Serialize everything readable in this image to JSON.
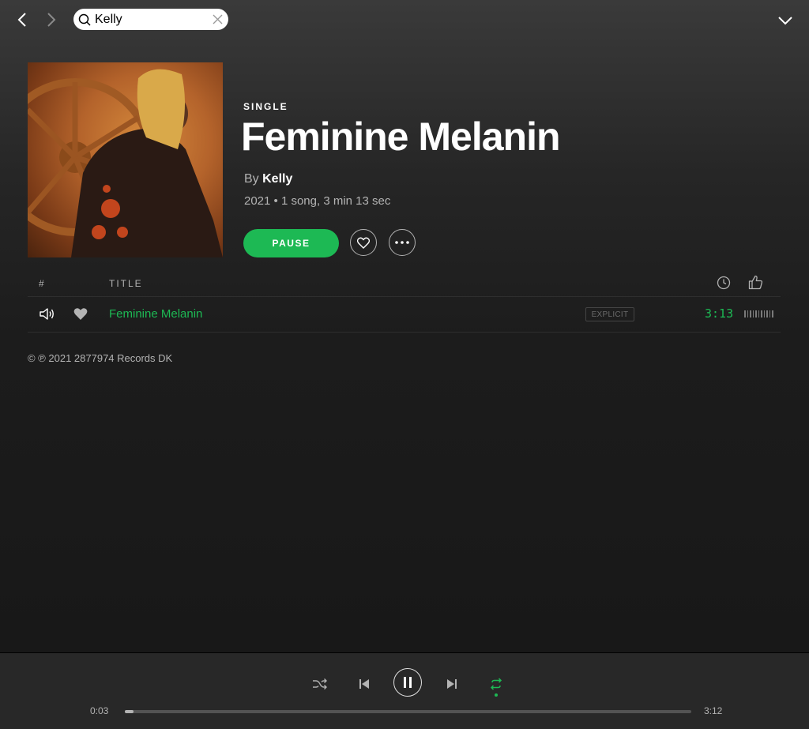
{
  "search": {
    "value": "Kelly"
  },
  "album": {
    "type_label": "SINGLE",
    "title": "Feminine Melanin",
    "by_prefix": "By",
    "artist": "Kelly",
    "meta": "2021 • 1 song, 3 min 13 sec",
    "pause_label": "PAUSE"
  },
  "table": {
    "col_number": "#",
    "col_title": "TITLE",
    "tracks": [
      {
        "title": "Feminine Melanin",
        "explicit_label": "EXPLICIT",
        "duration": "3:13",
        "now_playing": true,
        "liked": true,
        "popularity_bars": 11
      }
    ]
  },
  "copyright": "© ℗ 2021 2877974 Records DK",
  "player": {
    "elapsed": "0:03",
    "total": "3:12",
    "progress_fraction": 0.016,
    "repeat_active": true
  },
  "colors": {
    "accent": "#1db954",
    "background": "#181818",
    "player_bg": "#282828"
  },
  "icons": [
    "back-icon",
    "forward-icon",
    "search-icon",
    "clear-icon",
    "chevron-down-icon",
    "heart-outline-icon",
    "more-icon",
    "clock-icon",
    "thumbs-up-icon",
    "speaker-icon",
    "heart-filled-icon",
    "shuffle-icon",
    "previous-icon",
    "pause-icon",
    "next-icon",
    "repeat-icon"
  ]
}
